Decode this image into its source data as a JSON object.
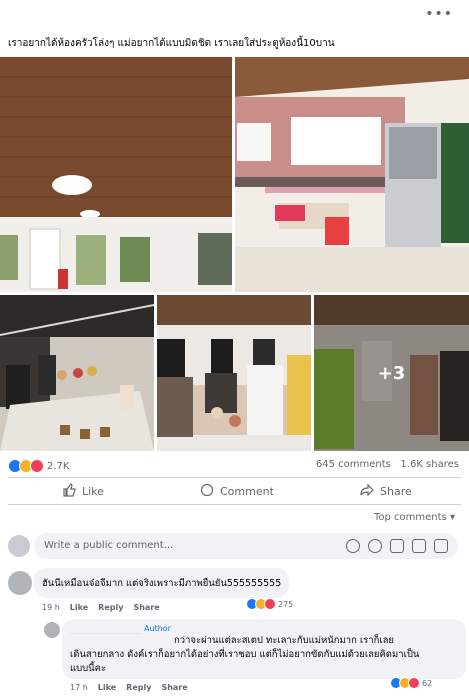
{
  "post": {
    "more_label": "•••",
    "caption": "เราอยากได้ห้องครัวโล่งๆ แม่อยากได้แบบมิดชิด เราเลยใส่ประตูห้องนี้10บาน",
    "photo_overlay": "+3",
    "reaction_count": "2.7K",
    "comment_count": "645 comments",
    "share_count": "1.6K shares"
  },
  "actions": {
    "like": "Like",
    "comment": "Comment",
    "share": "Share"
  },
  "comments_section": {
    "sort_label": "Top comments",
    "placeholder": "Write a public comment...",
    "comments": [
      {
        "text": "ฮันนีเหมือนจ๋อจีมาก แต่จริงเพราะมีภาพยืนยัน555555555",
        "time": "19 h",
        "like": "Like",
        "reply": "Reply",
        "share": "Share",
        "reactions": "275"
      },
      {
        "author_badge": "Author",
        "line1": "กว่าจะผ่านแต่ละสเตป ทะเลาะกับแม่หนักมาก เราก็เลย",
        "line2": "เดินสายกลาง ดังค์เราก็อยากได้อย่างที่เราชอบ แต่ก็ไม่อยากขัดกับแม่ด้วยเลยคิดมาเป็น",
        "line3": "แบบนี้คะ",
        "time": "17 h",
        "like": "Like",
        "reply": "Reply",
        "share": "Share",
        "reactions": "62"
      }
    ]
  },
  "colors": {
    "meta_gray": "#65676b",
    "bubble": "#f0f2f5",
    "like_blue": "#1877f2",
    "love_red": "#f33e58",
    "haha_yellow": "#f7b125"
  }
}
